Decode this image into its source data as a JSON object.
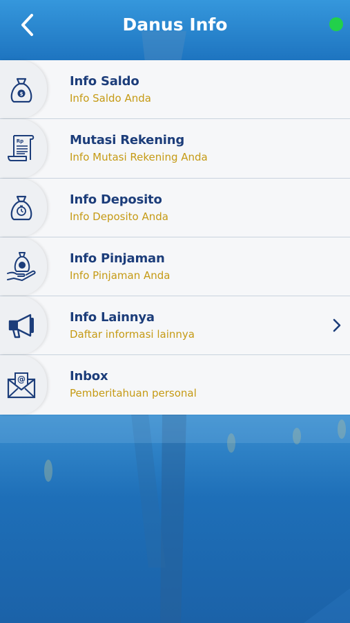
{
  "header": {
    "title": "Danus Info",
    "back_icon": "chevron-left-icon",
    "status_color": "#22d04a"
  },
  "menu": {
    "items": [
      {
        "icon": "money-bag-icon",
        "title": "Info Saldo",
        "subtitle": "Info Saldo Anda",
        "has_chevron": false
      },
      {
        "icon": "receipt-icon",
        "title": "Mutasi Rekening",
        "subtitle": "Info Mutasi Rekening Anda",
        "has_chevron": false
      },
      {
        "icon": "deposit-bag-icon",
        "title": "Info Deposito",
        "subtitle": "Info Deposito Anda",
        "has_chevron": false
      },
      {
        "icon": "loan-hand-icon",
        "title": "Info Pinjaman",
        "subtitle": "Info Pinjaman Anda",
        "has_chevron": false
      },
      {
        "icon": "megaphone-icon",
        "title": "Info Lainnya",
        "subtitle": "Daftar informasi lainnya",
        "has_chevron": true
      },
      {
        "icon": "mail-icon",
        "title": "Inbox",
        "subtitle": "Pemberitahuan personal",
        "has_chevron": false
      }
    ]
  },
  "colors": {
    "title_text": "#1c3d7a",
    "subtitle_text": "#c59a14",
    "icon_stroke": "#1c3d7a",
    "background": "#1f78c4"
  }
}
